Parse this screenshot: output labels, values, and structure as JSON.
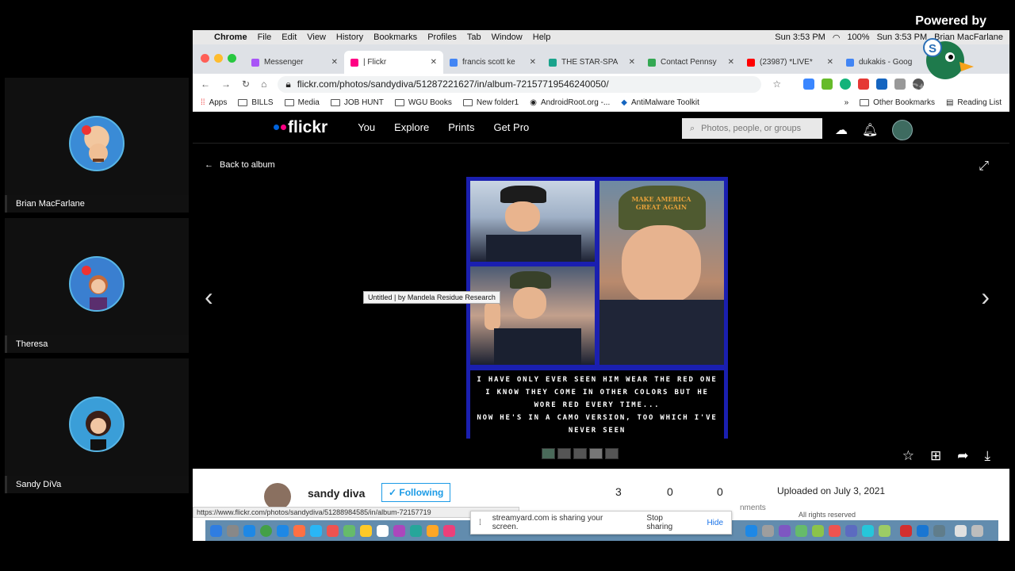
{
  "powered_by": "Powered by",
  "participants": [
    {
      "name": "Brian MacFarlane"
    },
    {
      "name": "Theresa"
    },
    {
      "name": "Sandy DiVa"
    }
  ],
  "mac_menubar": {
    "app": "Chrome",
    "menus": [
      "File",
      "Edit",
      "View",
      "History",
      "Bookmarks",
      "Profiles",
      "Tab",
      "Window",
      "Help"
    ],
    "time1": "Sun 3:53 PM",
    "battery": "100%",
    "time2": "Sun 3:53 PM",
    "user": "Brian MacFarlane"
  },
  "tabs": [
    {
      "title": "Messenger",
      "color": "#a855f7"
    },
    {
      "title": "| Flickr",
      "color": "#ff0084",
      "active": true
    },
    {
      "title": "francis scott ke",
      "color": "#4285f4"
    },
    {
      "title": "THE STAR-SPA",
      "color": "#1aa38c"
    },
    {
      "title": "Contact Pennsy",
      "color": "#34a853"
    },
    {
      "title": "(23987) *LIVE*",
      "color": "#ff0000"
    },
    {
      "title": "dukakis - Goog",
      "color": "#4285f4"
    }
  ],
  "url": "flickr.com/photos/sandydiva/51287221627/in/album-72157719546240050/",
  "bookmarks": [
    "Apps",
    "BILLS",
    "Media",
    "JOB HUNT",
    "WGU Books",
    "New folder1",
    "AndroidRoot.org -...",
    "AntiMalware Toolkit",
    "Other Bookmarks",
    "Reading List"
  ],
  "flickr": {
    "logo": "flickr",
    "nav": [
      "You",
      "Explore",
      "Prints",
      "Get Pro"
    ],
    "search_placeholder": "Photos, people, or groups",
    "back": "Back to album",
    "tooltip": "Untitled | by Mandela Residue Research",
    "caption_lines": [
      "I HAVE ONLY EVER SEEN HIM WEAR THE RED ONE",
      "I KNOW THEY COME IN OTHER COLORS BUT HE",
      "WORE RED EVERY TIME...",
      "NOW HE'S IN A CAMO VERSION, TOO WHICH I'VE",
      "NEVER SEEN"
    ],
    "hat_text": "MAKE AMERICA GREAT AGAIN",
    "user": "sandy diva",
    "follow": "✓ Following",
    "stats": [
      "3",
      "0",
      "0"
    ],
    "stat_partial": "nments",
    "uploaded": "Uploaded on July 3, 2021",
    "rights_partial": "All rights reserved"
  },
  "status_url": "https://www.flickr.com/photos/sandydiva/51288984585/in/album-72157719",
  "sharebar": {
    "message": "streamyard.com is sharing your screen.",
    "stop": "Stop sharing",
    "hide": "Hide"
  },
  "watermark": "StreamYard"
}
